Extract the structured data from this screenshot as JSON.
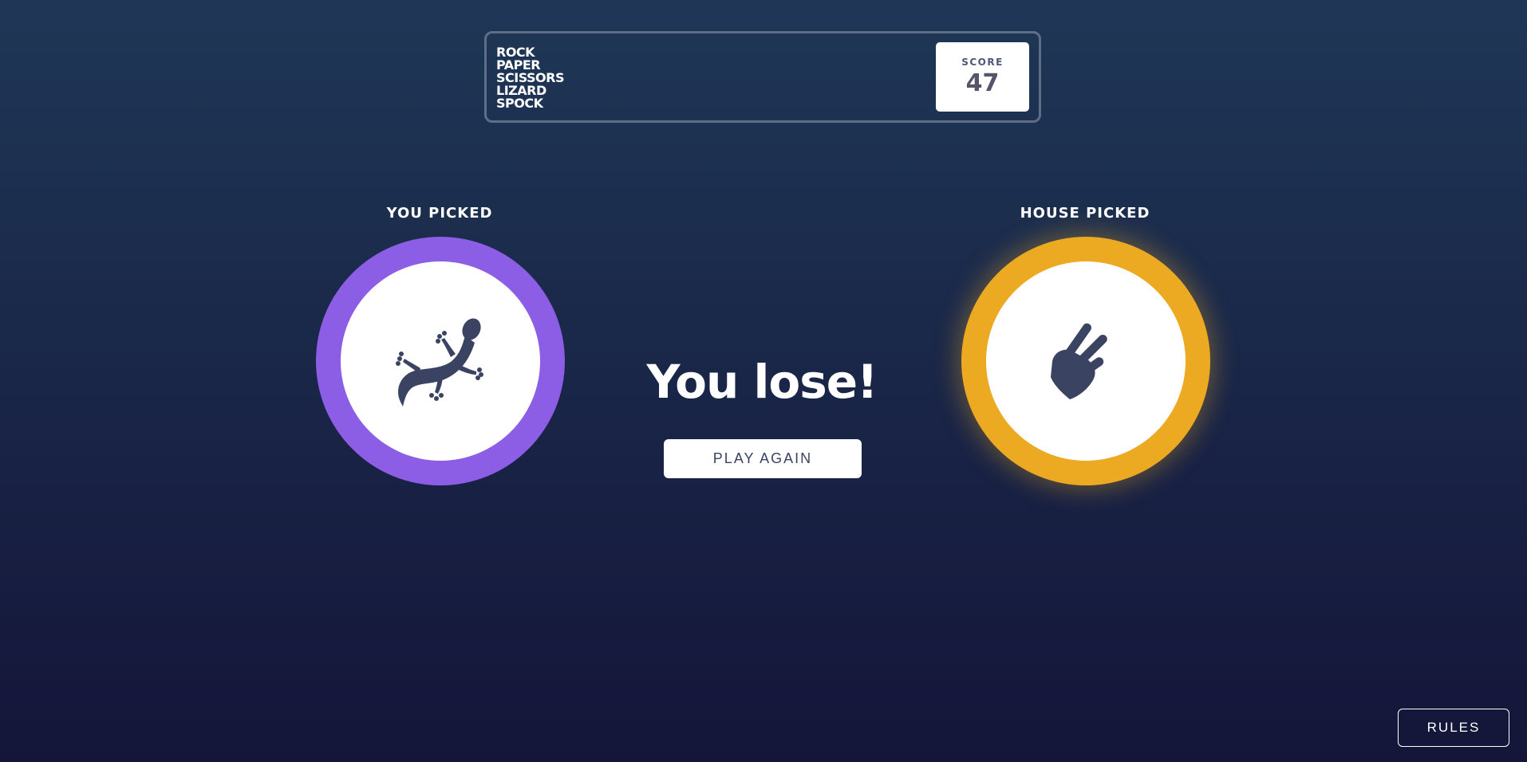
{
  "header": {
    "logo_lines": [
      "ROCK",
      "PAPER",
      "SCISSORS",
      "LIZARD",
      "SPOCK"
    ],
    "score_label": "SCORE",
    "score_value": "47"
  },
  "player": {
    "title": "YOU PICKED",
    "choice": "lizard",
    "icon": "lizard-icon",
    "ring_color": "#8c5de5"
  },
  "house": {
    "title": "HOUSE PICKED",
    "choice": "scissors",
    "icon": "scissors-hand-icon",
    "ring_color": "#eca922"
  },
  "result": {
    "text": "You lose!",
    "button_label": "PLAY AGAIN"
  },
  "footer": {
    "rules_label": "RULES"
  },
  "colors": {
    "icon_fill": "#3b4363"
  }
}
